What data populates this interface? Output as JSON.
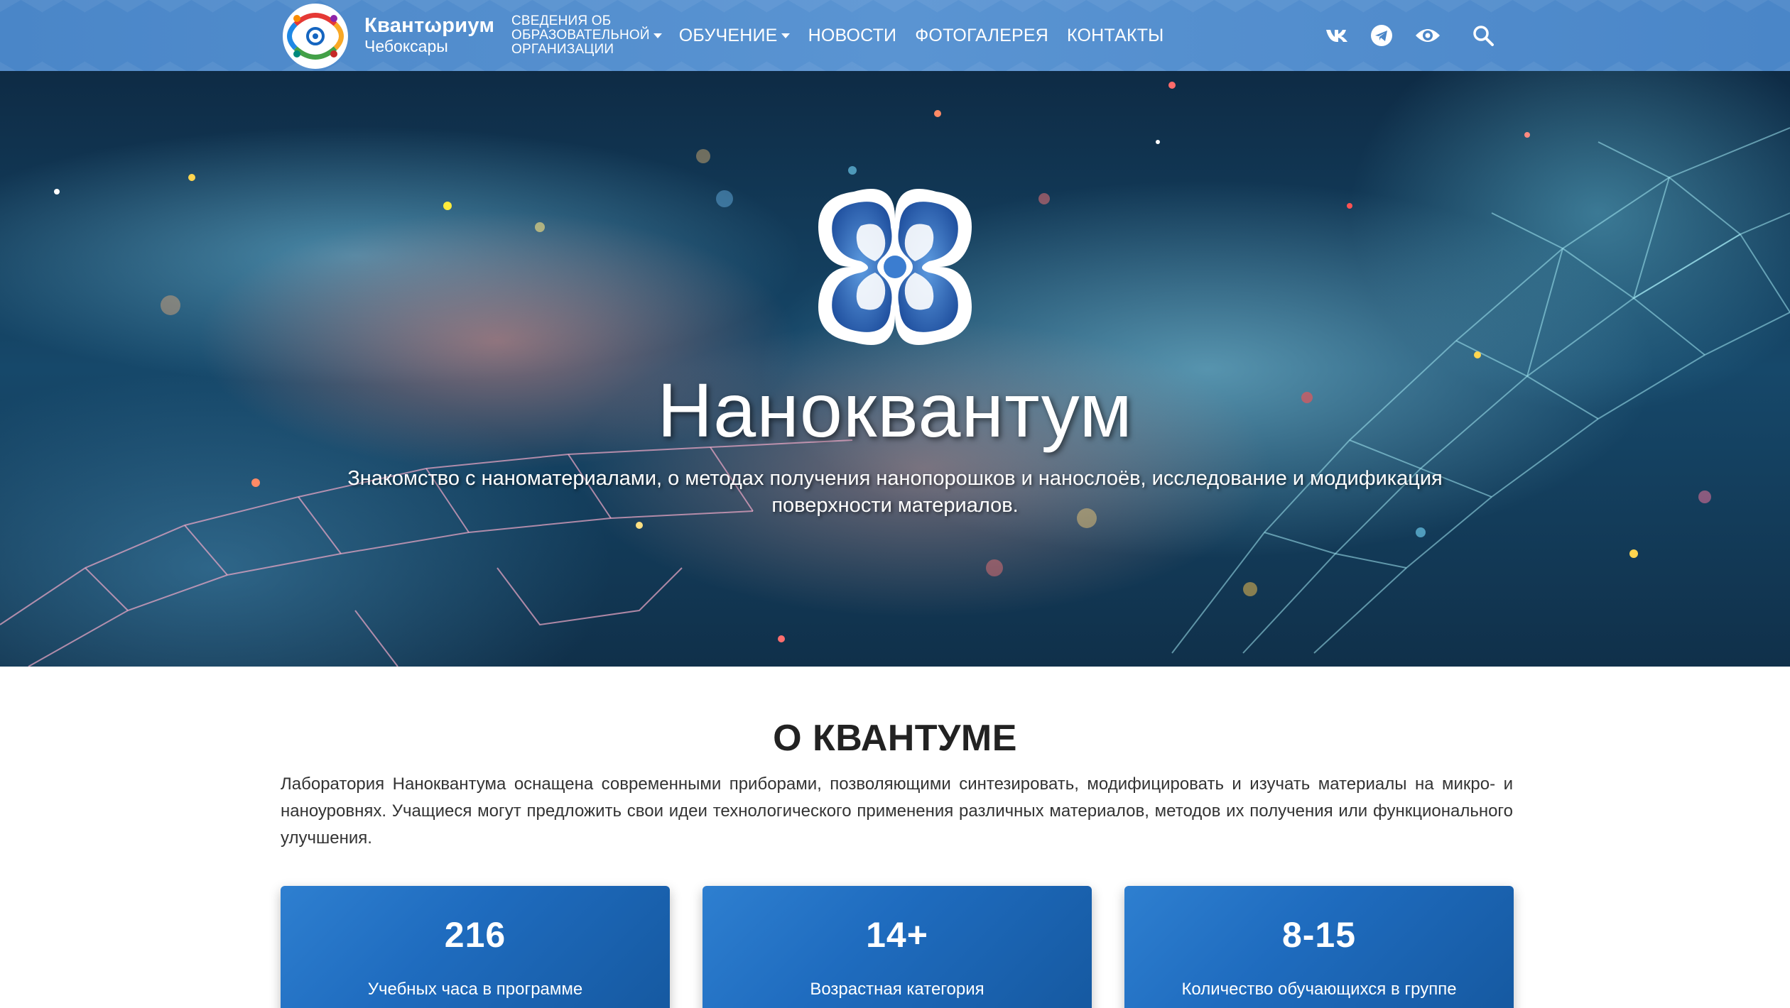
{
  "header": {
    "brand_name": "Квантωриум",
    "brand_city": "Чебоксары",
    "nav": {
      "info_line1": "СВЕДЕНИЯ ОБ",
      "info_line2": "ОБРАЗОВАТЕЛЬНОЙ",
      "info_line3": "ОРГАНИЗАЦИИ",
      "education": "ОБУЧЕНИЕ",
      "news": "НОВОСТИ",
      "gallery": "ФОТОГАЛЕРЕЯ",
      "contacts": "КОНТАКТЫ"
    },
    "icons": [
      "vk-icon",
      "telegram-icon",
      "eye-icon",
      "search-icon"
    ]
  },
  "hero": {
    "title": "Наноквантум",
    "subtitle": "Знакомство с наноматериалами, о методах получения нанопорошков и нанослоёв, исследование и модификация поверхности материалов."
  },
  "about": {
    "title": "О КВАНТУМЕ",
    "text": "Лаборатория Наноквантума оснащена современными приборами, позволяющими синтезировать, модифицировать и изучать материалы на микро- и наноуровнях. Учащиеся могут предложить свои идеи технологического применения различных материалов, методов их получения или функционального улучшения."
  },
  "stats": [
    {
      "value": "216",
      "label": "Учебных часа в программе"
    },
    {
      "value": "14+",
      "label": "Возрастная категория"
    },
    {
      "value": "8-15",
      "label": "Количество обучающихся в группе"
    }
  ],
  "colors": {
    "header_bg": "#4a86c8",
    "card_bg": "#1f6cbf",
    "logo_blue": "#2f67b8"
  }
}
